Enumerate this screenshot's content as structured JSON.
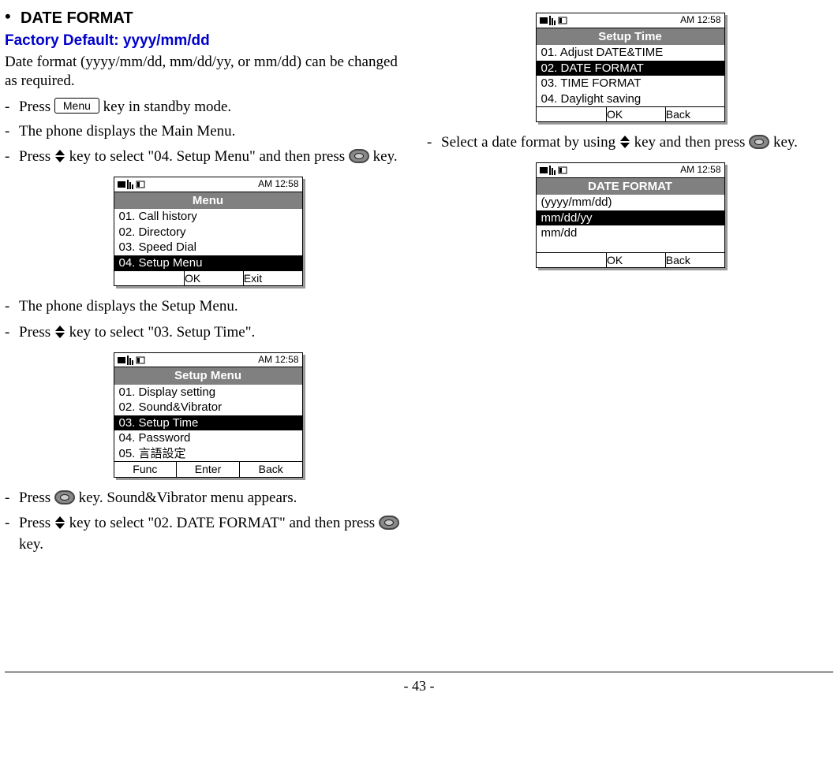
{
  "heading": {
    "bullet": "•",
    "title": "DATE FORMAT",
    "factory": "Factory Default: yyyy/mm/dd",
    "intro": "Date format (yyyy/mm/dd, mm/dd/yy, or mm/dd) can be changed as required."
  },
  "left_steps": {
    "s1a_pre": "Press ",
    "menu_key": "Menu",
    "s1a_post": " key in standby mode.",
    "s1b": "The phone displays the Main Menu.",
    "s2_pre": "Press ",
    "s2_mid": " key to select \"04. Setup Menu\" and then press ",
    "s2_post": "  key.",
    "s3": "The phone displays the Setup Menu.",
    "s4_pre": "Press ",
    "s4_post": " key to select \"03. Setup Time\".",
    "s5_pre": "Press ",
    "s5_post": "  key. Sound&Vibrator menu appears.",
    "s6_pre": "Press ",
    "s6_mid": " key to select \"02. DATE FORMAT\" and then press ",
    "s6_post": " key."
  },
  "right_steps": {
    "s1_pre": "Select a date format by using ",
    "s1_mid": " key and then press ",
    "s1_post": " key."
  },
  "clock": "AM 12:58",
  "screens": {
    "menu": {
      "title": "Menu",
      "items": [
        "01. Call history",
        "02. Directory",
        "03. Speed Dial",
        "04. Setup Menu"
      ],
      "selected": 3,
      "softkeys": [
        "",
        "OK",
        "Exit"
      ]
    },
    "setup_menu": {
      "title": "Setup Menu",
      "items": [
        "01. Display setting",
        "02. Sound&Vibrator",
        "03. Setup Time",
        "04. Password",
        "05. 言語設定"
      ],
      "selected": 2,
      "softkeys": [
        "Func",
        "Enter",
        "Back"
      ]
    },
    "setup_time": {
      "title": "Setup Time",
      "items": [
        "01. Adjust DATE&TIME",
        "02. DATE FORMAT",
        "03. TIME FORMAT",
        "04. Daylight saving"
      ],
      "selected": 1,
      "softkeys": [
        "",
        "OK",
        "Back"
      ]
    },
    "date_format": {
      "title": "DATE FORMAT",
      "items": [
        "(yyyy/mm/dd)",
        " mm/dd/yy",
        " mm/dd"
      ],
      "selected": 1,
      "softkeys": [
        "",
        "OK",
        "Back"
      ]
    }
  },
  "page_number": "- 43 -"
}
